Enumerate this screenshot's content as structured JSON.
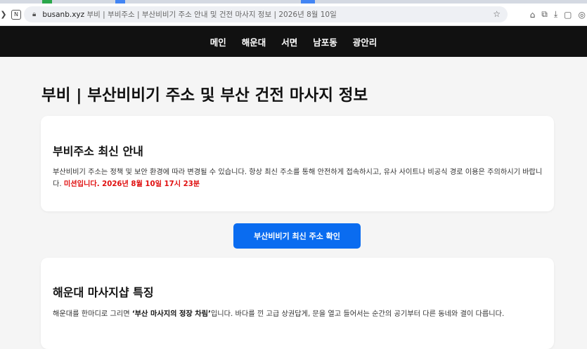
{
  "browser": {
    "url_domain": "busanb.xyz",
    "url_rest": "부비 | 부비주소 | 부산비비기 주소 안내 및 건전 마사지 정보 | 2026년 8월 10일",
    "reader_icon": "N",
    "icons": [
      "back-arrow-icon",
      "reader-mode-icon",
      "lock-icon",
      "bookmark-star-icon",
      "extensions-icon",
      "tab-search-icon",
      "download-icon",
      "sidebar-icon",
      "profile-icon"
    ]
  },
  "nav": {
    "items": [
      "메인",
      "해운대",
      "서면",
      "남포동",
      "광안리"
    ]
  },
  "page": {
    "title": "부비 | 부산비비기 주소 및 부산 건전 마사지 정보"
  },
  "notice_card": {
    "heading": "부비주소 최신 안내",
    "body": "부산비비기 주소는 정책 및 보안 환경에 따라 변경될 수 있습니다. 항상 최신 주소를 통해 안전하게 접속하시고, 유사 사이트나 비공식 경로 이용은 주의하시기 바랍니다. ",
    "highlight": "미션입니다. 2026년 8월 10일 17시 23분"
  },
  "cta": {
    "label": "부산비비기 최신 주소 확인"
  },
  "haeundae_card": {
    "heading": "해운대 마사지샵 특징",
    "body_before": "해운대를 한마디로 그리면 ",
    "body_bold": "‘부산 마사지의 정장 차림’",
    "body_after": "입니다. 바다를 낀 고급 상권답게, 문을 열고 들어서는 순간의 공기부터 다른 동네와 결이 다릅니다."
  },
  "colors": {
    "nav_bg": "#111111",
    "cta_bg": "#0a6cf0",
    "highlight": "#e01010",
    "page_bg": "#f5f5f5"
  }
}
